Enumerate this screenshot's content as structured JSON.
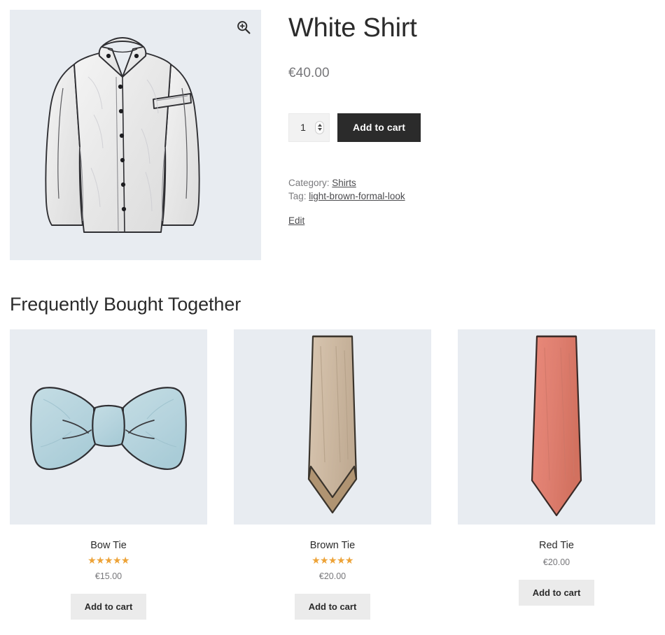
{
  "product": {
    "title": "White Shirt",
    "price": "€40.00",
    "quantity_value": "1",
    "add_to_cart_label": "Add to cart",
    "zoom_icon": "magnifier-plus-icon",
    "image_alt": "white-dress-shirt-illustration",
    "meta": {
      "category_label": "Category:",
      "category_value": "Shirts",
      "tag_label": "Tag:",
      "tag_value": "light-brown-formal-look",
      "edit_label": "Edit"
    }
  },
  "frequently_bought_together": {
    "heading": "Frequently Bought Together",
    "items": [
      {
        "title": "Bow Tie",
        "price": "€15.00",
        "rating": 5,
        "stars": "★★★★★",
        "has_rating": true,
        "add_to_cart_label": "Add to cart",
        "image_alt": "light-blue-bow-tie-illustration",
        "color": "#b9d6df"
      },
      {
        "title": "Brown Tie",
        "price": "€20.00",
        "rating": 5,
        "stars": "★★★★★",
        "has_rating": true,
        "add_to_cart_label": "Add to cart",
        "image_alt": "brown-necktie-illustration",
        "color": "#cfbba4"
      },
      {
        "title": "Red Tie",
        "price": "€20.00",
        "rating": 0,
        "stars": "",
        "has_rating": false,
        "add_to_cart_label": "Add to cart",
        "image_alt": "red-necktie-illustration",
        "color": "#e08070"
      }
    ]
  },
  "theme": {
    "image_bg": "#e8ecf1",
    "accent_dark": "#2b2b2b",
    "star_color": "#eda338",
    "edit_link_color": "#a14d7d",
    "muted_text": "#77777a"
  }
}
